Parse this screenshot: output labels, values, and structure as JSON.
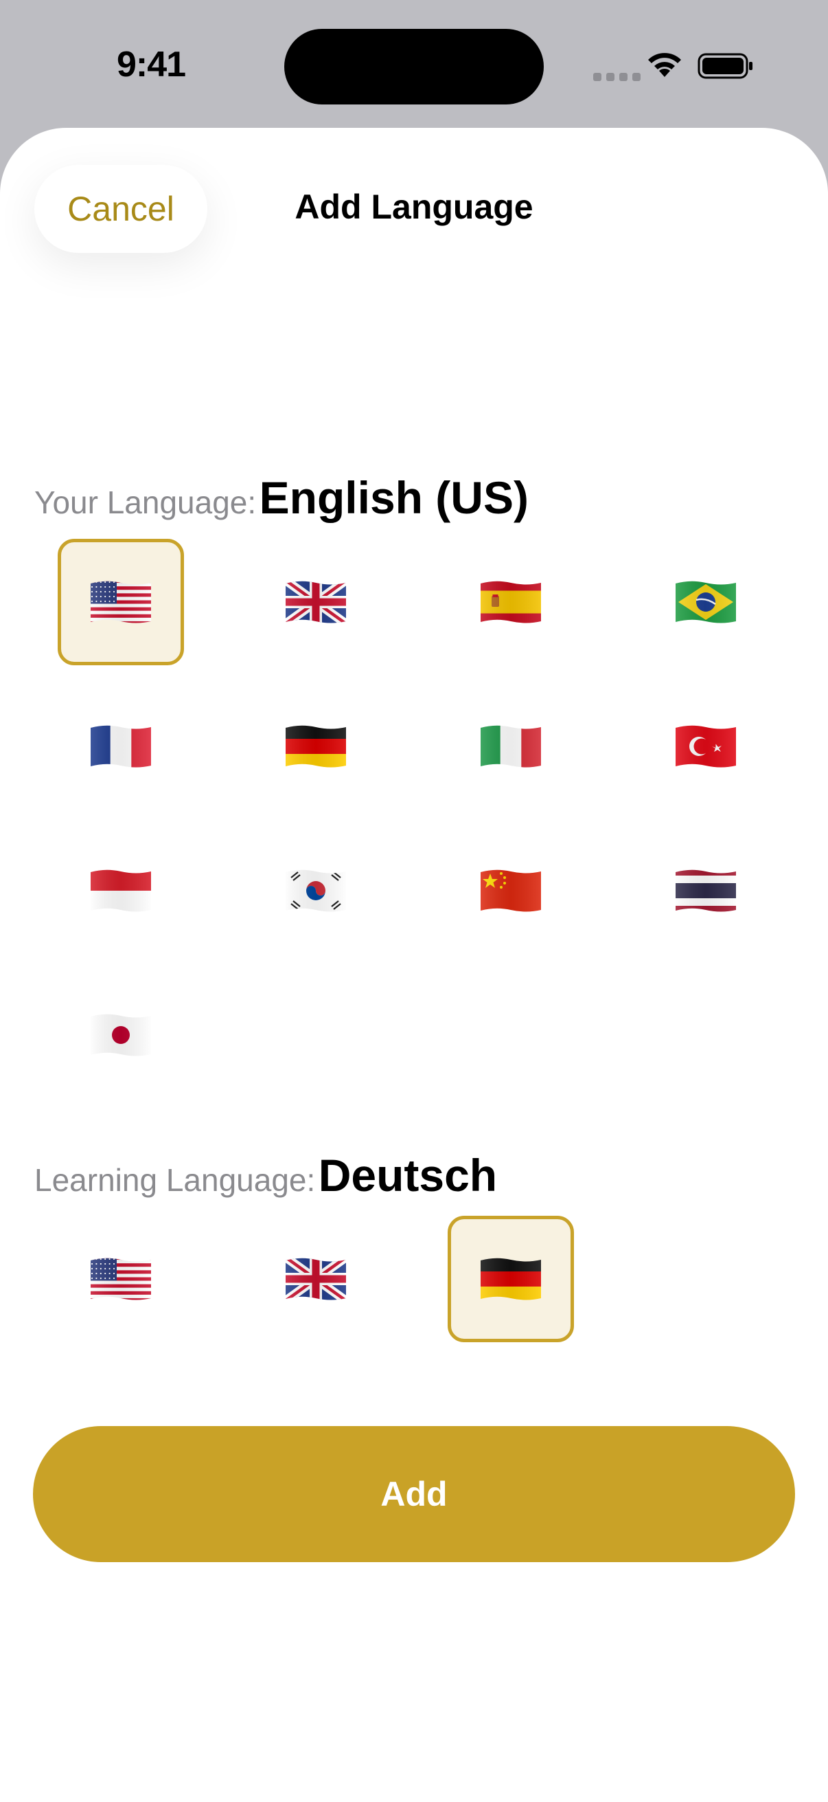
{
  "status_bar": {
    "time": "9:41"
  },
  "header": {
    "cancel_label": "Cancel",
    "title": "Add Language"
  },
  "your_language": {
    "prefix": "Your Language:",
    "selected": "English (US)",
    "flags": [
      "us-flag",
      "uk-flag",
      "spain-flag",
      "brazil-flag",
      "france-flag",
      "germany-flag",
      "italy-flag",
      "turkey-flag",
      "indonesia-flag",
      "south-korea-flag",
      "china-flag",
      "thailand-flag",
      "japan-flag"
    ],
    "selected_flag": "us-flag"
  },
  "learning_language": {
    "prefix": "Learning Language:",
    "selected": "Deutsch",
    "flags": [
      "us-flag",
      "uk-flag",
      "germany-flag"
    ],
    "selected_flag": "germany-flag"
  },
  "footer": {
    "add_label": "Add"
  },
  "colors": {
    "accent": "#c9a227",
    "cancel_text": "#a88a18",
    "selected_bg": "#f8f2e1",
    "selected_border": "#c9a32a"
  }
}
